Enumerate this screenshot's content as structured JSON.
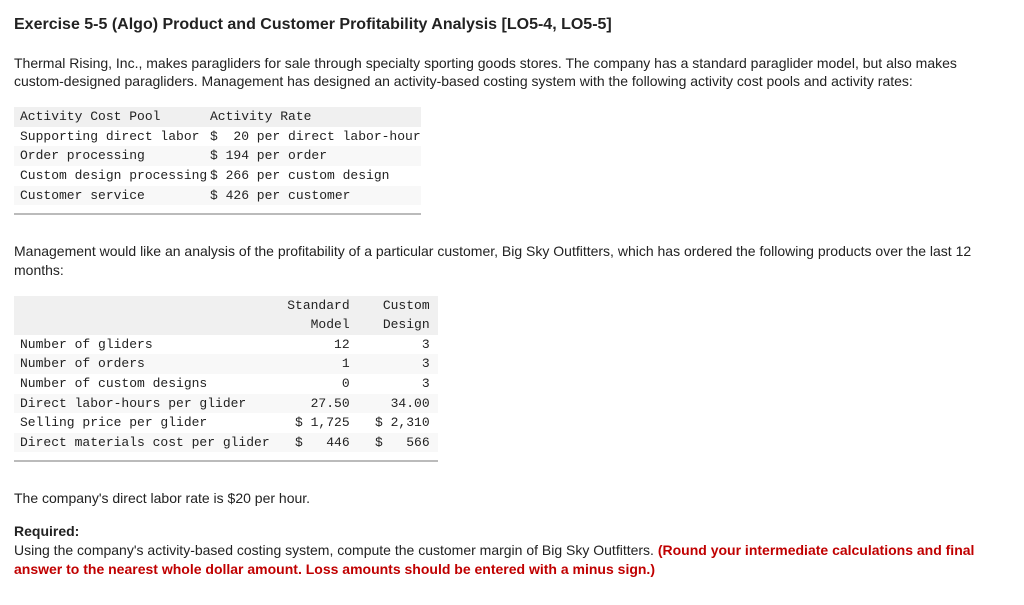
{
  "title": "Exercise 5-5 (Algo) Product and Customer Profitability Analysis [LO5-4, LO5-5]",
  "intro": "Thermal Rising, Inc., makes paragliders for sale through specialty sporting goods stores. The company has a standard paraglider model, but also makes custom-designed paragliders. Management has designed an activity-based costing system with the following activity cost pools and activity rates:",
  "table1": {
    "headers": [
      "Activity Cost Pool",
      "Activity Rate"
    ],
    "rows": [
      [
        "Supporting direct labor",
        "$  20 per direct labor-hour"
      ],
      [
        "Order processing",
        "$ 194 per order"
      ],
      [
        "Custom design processing",
        "$ 266 per custom design"
      ],
      [
        "Customer service",
        "$ 426 per customer"
      ]
    ]
  },
  "mid_text": "Management would like an analysis of the profitability of a particular customer, Big Sky Outfitters, which has ordered the following products over the last 12 months:",
  "table2": {
    "col_headers_line1": [
      "",
      "Standard",
      "Custom"
    ],
    "col_headers_line2": [
      "",
      "Model",
      "Design"
    ],
    "rows": [
      [
        "Number of gliders",
        "12",
        "3"
      ],
      [
        "Number of orders",
        "1",
        "3"
      ],
      [
        "Number of custom designs",
        "0",
        "3"
      ],
      [
        "Direct labor-hours per glider",
        "27.50",
        "34.00"
      ],
      [
        "Selling price per glider",
        "$ 1,725",
        "$ 2,310"
      ],
      [
        "Direct materials cost per glider",
        "$   446",
        "$   566"
      ]
    ]
  },
  "labor_rate_text": "The company's direct labor rate is $20 per hour.",
  "required_label": "Required:",
  "required_plain": "Using the company's activity-based costing system, compute the customer margin of Big Sky Outfitters. ",
  "required_red": "(Round your intermediate calculations and final answer to the nearest whole dollar amount. Loss amounts should be entered with a minus sign.)"
}
